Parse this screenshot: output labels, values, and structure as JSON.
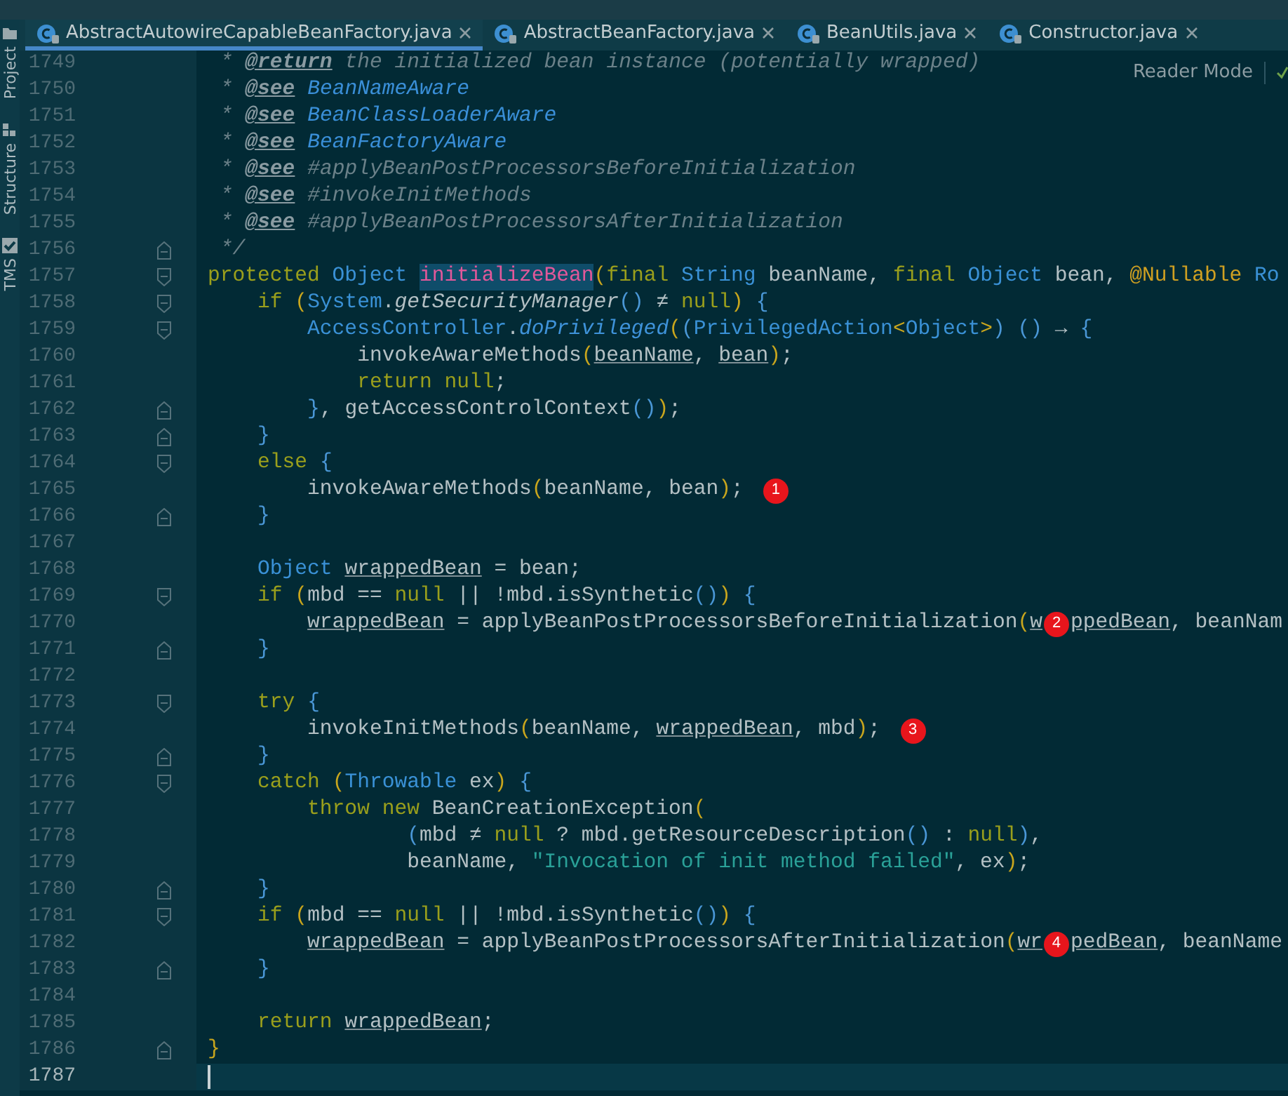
{
  "tool_windows": [
    {
      "label": "Project",
      "kind": "folder"
    },
    {
      "label": "Structure",
      "kind": "structure"
    },
    {
      "label": "TMS",
      "kind": "check"
    }
  ],
  "tabs": [
    {
      "label": "AbstractAutowireCapableBeanFactory.java",
      "selected": true
    },
    {
      "label": "AbstractBeanFactory.java",
      "selected": false
    },
    {
      "label": "BeanUtils.java",
      "selected": false
    },
    {
      "label": "Constructor.java",
      "selected": false
    }
  ],
  "reader_mode": "Reader Mode",
  "lines": [
    {
      "number": "1749",
      "current": false,
      "tokens": [
        {
          "kind": "comment",
          "text": " * "
        },
        {
          "kind": "doc-tag",
          "text": "@return"
        },
        {
          "kind": "comment",
          "text": " the initialized bean instance (potentially wrapped)"
        }
      ]
    },
    {
      "number": "1750",
      "current": false,
      "tokens": [
        {
          "kind": "comment",
          "text": " * "
        },
        {
          "kind": "doc-tag",
          "text": "@see"
        },
        {
          "kind": "doc-link",
          "text": " BeanNameAware"
        }
      ]
    },
    {
      "number": "1751",
      "current": false,
      "tokens": [
        {
          "kind": "comment",
          "text": " * "
        },
        {
          "kind": "doc-tag",
          "text": "@see"
        },
        {
          "kind": "doc-link",
          "text": " BeanClassLoaderAware"
        }
      ]
    },
    {
      "number": "1752",
      "current": false,
      "tokens": [
        {
          "kind": "comment",
          "text": " * "
        },
        {
          "kind": "doc-tag",
          "text": "@see"
        },
        {
          "kind": "doc-link",
          "text": " BeanFactoryAware"
        }
      ]
    },
    {
      "number": "1753",
      "current": false,
      "tokens": [
        {
          "kind": "comment",
          "text": " * "
        },
        {
          "kind": "doc-tag",
          "text": "@see"
        },
        {
          "kind": "comment",
          "text": " #applyBeanPostProcessorsBeforeInitialization"
        }
      ]
    },
    {
      "number": "1754",
      "current": false,
      "tokens": [
        {
          "kind": "comment",
          "text": " * "
        },
        {
          "kind": "doc-tag",
          "text": "@see"
        },
        {
          "kind": "comment",
          "text": " #invokeInitMethods"
        }
      ]
    },
    {
      "number": "1755",
      "current": false,
      "tokens": [
        {
          "kind": "comment",
          "text": " * "
        },
        {
          "kind": "doc-tag",
          "text": "@see"
        },
        {
          "kind": "comment",
          "text": " #applyBeanPostProcessorsAfterInitialization"
        }
      ]
    },
    {
      "number": "1756",
      "current": false,
      "fold_marker": {
        "kind": "end"
      },
      "tokens": [
        {
          "kind": "comment",
          "text": " */"
        }
      ]
    },
    {
      "number": "1757",
      "current": false,
      "fold_marker": {
        "kind": "start"
      },
      "tokens": [
        {
          "kind": "keyword",
          "text": "protected "
        },
        {
          "kind": "type",
          "text": "Object "
        },
        {
          "kind": "highlight",
          "text": "initializeBean"
        },
        {
          "kind": "bracket",
          "text": "("
        },
        {
          "kind": "keyword",
          "text": "final "
        },
        {
          "kind": "type",
          "text": "String "
        },
        {
          "kind": "plain",
          "text": "beanName, "
        },
        {
          "kind": "keyword",
          "text": "final "
        },
        {
          "kind": "type",
          "text": "Object "
        },
        {
          "kind": "plain",
          "text": "bean, "
        },
        {
          "kind": "annotation",
          "text": "@Nullable "
        },
        {
          "kind": "type",
          "text": "Ro"
        }
      ]
    },
    {
      "number": "1758",
      "current": false,
      "fold_marker": {
        "kind": "start"
      },
      "tokens": [
        {
          "kind": "keyword",
          "text": "    if "
        },
        {
          "kind": "bracket",
          "text": "("
        },
        {
          "kind": "type",
          "text": "System"
        },
        {
          "kind": "plain",
          "text": "."
        },
        {
          "kind": "static",
          "text": "getSecurityManager"
        },
        {
          "kind": "brace",
          "text": "()"
        },
        {
          "kind": "plain",
          "text": " ≠ "
        },
        {
          "kind": "keyword",
          "text": "null"
        },
        {
          "kind": "bracket",
          "text": ")"
        },
        {
          "kind": "brace",
          "text": " {"
        }
      ]
    },
    {
      "number": "1759",
      "current": false,
      "fold_marker": {
        "kind": "start"
      },
      "tokens": [
        {
          "kind": "type",
          "text": "        AccessController"
        },
        {
          "kind": "plain",
          "text": "."
        },
        {
          "kind": "static-call",
          "text": "doPrivileged"
        },
        {
          "kind": "bracket",
          "text": "("
        },
        {
          "kind": "brace",
          "text": "("
        },
        {
          "kind": "type",
          "text": "PrivilegedAction"
        },
        {
          "kind": "bracket",
          "text": "<"
        },
        {
          "kind": "type",
          "text": "Object"
        },
        {
          "kind": "bracket",
          "text": ">"
        },
        {
          "kind": "brace",
          "text": ") ()"
        },
        {
          "kind": "plain",
          "text": " → "
        },
        {
          "kind": "brace",
          "text": "{"
        }
      ]
    },
    {
      "number": "1760",
      "current": false,
      "tokens": [
        {
          "kind": "plain",
          "text": "            invokeAwareMethods"
        },
        {
          "kind": "bracket",
          "text": "("
        },
        {
          "kind": "variable",
          "text": "beanName"
        },
        {
          "kind": "plain",
          "text": ", "
        },
        {
          "kind": "variable",
          "text": "bean"
        },
        {
          "kind": "bracket",
          "text": ")"
        },
        {
          "kind": "plain",
          "text": ";"
        }
      ]
    },
    {
      "number": "1761",
      "current": false,
      "tokens": [
        {
          "kind": "keyword",
          "text": "            return null"
        },
        {
          "kind": "plain",
          "text": ";"
        }
      ]
    },
    {
      "number": "1762",
      "current": false,
      "fold_marker": {
        "kind": "end"
      },
      "tokens": [
        {
          "kind": "brace",
          "text": "        }"
        },
        {
          "kind": "plain",
          "text": ", getAccessControlContext"
        },
        {
          "kind": "brace",
          "text": "()"
        },
        {
          "kind": "bracket",
          "text": ")"
        },
        {
          "kind": "plain",
          "text": ";"
        }
      ]
    },
    {
      "number": "1763",
      "current": false,
      "fold_marker": {
        "kind": "end"
      },
      "tokens": [
        {
          "kind": "brace",
          "text": "    }"
        }
      ]
    },
    {
      "number": "1764",
      "current": false,
      "fold_marker": {
        "kind": "start"
      },
      "tokens": [
        {
          "kind": "keyword",
          "text": "    else "
        },
        {
          "kind": "brace",
          "text": "{"
        }
      ]
    },
    {
      "number": "1765",
      "current": false,
      "tokens": [
        {
          "kind": "plain",
          "text": "        invokeAwareMethods"
        },
        {
          "kind": "bracket",
          "text": "("
        },
        {
          "kind": "plain",
          "text": "beanName, bean"
        },
        {
          "kind": "bracket",
          "text": ")"
        },
        {
          "kind": "plain",
          "text": ";"
        },
        {
          "kind": "marker",
          "text": "1"
        }
      ]
    },
    {
      "number": "1766",
      "current": false,
      "fold_marker": {
        "kind": "end"
      },
      "tokens": [
        {
          "kind": "brace",
          "text": "    }"
        }
      ]
    },
    {
      "number": "1767",
      "current": false
    },
    {
      "number": "1768",
      "current": false,
      "tokens": [
        {
          "kind": "type",
          "text": "    Object "
        },
        {
          "kind": "variable",
          "text": "wrappedBean"
        },
        {
          "kind": "plain",
          "text": " = bean;"
        }
      ]
    },
    {
      "number": "1769",
      "current": false,
      "fold_marker": {
        "kind": "start"
      },
      "tokens": [
        {
          "kind": "keyword",
          "text": "    if "
        },
        {
          "kind": "bracket",
          "text": "("
        },
        {
          "kind": "plain",
          "text": "mbd == "
        },
        {
          "kind": "keyword",
          "text": "null"
        },
        {
          "kind": "plain",
          "text": " || !mbd.isSynthetic"
        },
        {
          "kind": "brace",
          "text": "()"
        },
        {
          "kind": "bracket",
          "text": ")"
        },
        {
          "kind": "brace",
          "text": " {"
        }
      ]
    },
    {
      "number": "1770",
      "current": false,
      "tokens": [
        {
          "kind": "variable",
          "text": "        wrappedBean"
        },
        {
          "kind": "plain",
          "text": " = applyBeanPostProcessorsBeforeInitialization"
        },
        {
          "kind": "bracket",
          "text": "("
        },
        {
          "kind": "variable",
          "text": "w"
        },
        {
          "kind": "marker",
          "text": "2"
        },
        {
          "kind": "variable",
          "text": "ppedBean"
        },
        {
          "kind": "plain",
          "text": ", beanNam"
        }
      ]
    },
    {
      "number": "1771",
      "current": false,
      "fold_marker": {
        "kind": "end"
      },
      "tokens": [
        {
          "kind": "brace",
          "text": "    }"
        }
      ]
    },
    {
      "number": "1772",
      "current": false
    },
    {
      "number": "1773",
      "current": false,
      "fold_marker": {
        "kind": "start"
      },
      "tokens": [
        {
          "kind": "keyword",
          "text": "    try "
        },
        {
          "kind": "brace",
          "text": "{"
        }
      ]
    },
    {
      "number": "1774",
      "current": false,
      "tokens": [
        {
          "kind": "plain",
          "text": "        invokeInitMethods"
        },
        {
          "kind": "bracket",
          "text": "("
        },
        {
          "kind": "plain",
          "text": "beanName, "
        },
        {
          "kind": "variable",
          "text": "wrappedBean"
        },
        {
          "kind": "plain",
          "text": ", mbd"
        },
        {
          "kind": "bracket",
          "text": ")"
        },
        {
          "kind": "plain",
          "text": ";"
        },
        {
          "kind": "marker",
          "text": "3"
        }
      ]
    },
    {
      "number": "1775",
      "current": false,
      "fold_marker": {
        "kind": "end"
      },
      "tokens": [
        {
          "kind": "brace",
          "text": "    }"
        }
      ]
    },
    {
      "number": "1776",
      "current": false,
      "fold_marker": {
        "kind": "start"
      },
      "tokens": [
        {
          "kind": "keyword",
          "text": "    catch "
        },
        {
          "kind": "bracket",
          "text": "("
        },
        {
          "kind": "type",
          "text": "Throwable"
        },
        {
          "kind": "plain",
          "text": " ex"
        },
        {
          "kind": "bracket",
          "text": ")"
        },
        {
          "kind": "brace",
          "text": " {"
        }
      ]
    },
    {
      "number": "1777",
      "current": false,
      "tokens": [
        {
          "kind": "keyword",
          "text": "        throw new "
        },
        {
          "kind": "plain",
          "text": "BeanCreationException"
        },
        {
          "kind": "bracket",
          "text": "("
        }
      ]
    },
    {
      "number": "1778",
      "current": false,
      "tokens": [
        {
          "kind": "brace",
          "text": "                ("
        },
        {
          "kind": "plain",
          "text": "mbd ≠ "
        },
        {
          "kind": "keyword",
          "text": "null"
        },
        {
          "kind": "plain",
          "text": " ? mbd.getResourceDescription"
        },
        {
          "kind": "brace",
          "text": "()"
        },
        {
          "kind": "plain",
          "text": " : "
        },
        {
          "kind": "keyword",
          "text": "null"
        },
        {
          "kind": "brace",
          "text": ")"
        },
        {
          "kind": "plain",
          "text": ","
        }
      ]
    },
    {
      "number": "1779",
      "current": false,
      "tokens": [
        {
          "kind": "plain",
          "text": "                beanName, "
        },
        {
          "kind": "string",
          "text": "\"Invocation of init method failed\""
        },
        {
          "kind": "plain",
          "text": ", ex"
        },
        {
          "kind": "bracket",
          "text": ")"
        },
        {
          "kind": "plain",
          "text": ";"
        }
      ]
    },
    {
      "number": "1780",
      "current": false,
      "fold_marker": {
        "kind": "end"
      },
      "tokens": [
        {
          "kind": "brace",
          "text": "    }"
        }
      ]
    },
    {
      "number": "1781",
      "current": false,
      "fold_marker": {
        "kind": "start"
      },
      "tokens": [
        {
          "kind": "keyword",
          "text": "    if "
        },
        {
          "kind": "bracket",
          "text": "("
        },
        {
          "kind": "plain",
          "text": "mbd == "
        },
        {
          "kind": "keyword",
          "text": "null"
        },
        {
          "kind": "plain",
          "text": " || !mbd.isSynthetic"
        },
        {
          "kind": "brace",
          "text": "()"
        },
        {
          "kind": "bracket",
          "text": ")"
        },
        {
          "kind": "brace",
          "text": " {"
        }
      ]
    },
    {
      "number": "1782",
      "current": false,
      "tokens": [
        {
          "kind": "variable",
          "text": "        wrappedBean"
        },
        {
          "kind": "plain",
          "text": " = applyBeanPostProcessorsAfterInitialization"
        },
        {
          "kind": "bracket",
          "text": "("
        },
        {
          "kind": "variable",
          "text": "wr"
        },
        {
          "kind": "marker",
          "text": "4"
        },
        {
          "kind": "variable",
          "text": "pedBean"
        },
        {
          "kind": "plain",
          "text": ", beanName"
        }
      ]
    },
    {
      "number": "1783",
      "current": false,
      "fold_marker": {
        "kind": "end"
      },
      "tokens": [
        {
          "kind": "brace",
          "text": "    }"
        }
      ]
    },
    {
      "number": "1784",
      "current": false
    },
    {
      "number": "1785",
      "current": false,
      "tokens": [
        {
          "kind": "keyword",
          "text": "    return "
        },
        {
          "kind": "variable",
          "text": "wrappedBean"
        },
        {
          "kind": "plain",
          "text": ";"
        }
      ]
    },
    {
      "number": "1786",
      "current": false,
      "fold_marker": {
        "kind": "end"
      },
      "tokens": [
        {
          "kind": "bracket",
          "text": "}"
        }
      ]
    },
    {
      "number": "1787",
      "current": true
    }
  ]
}
